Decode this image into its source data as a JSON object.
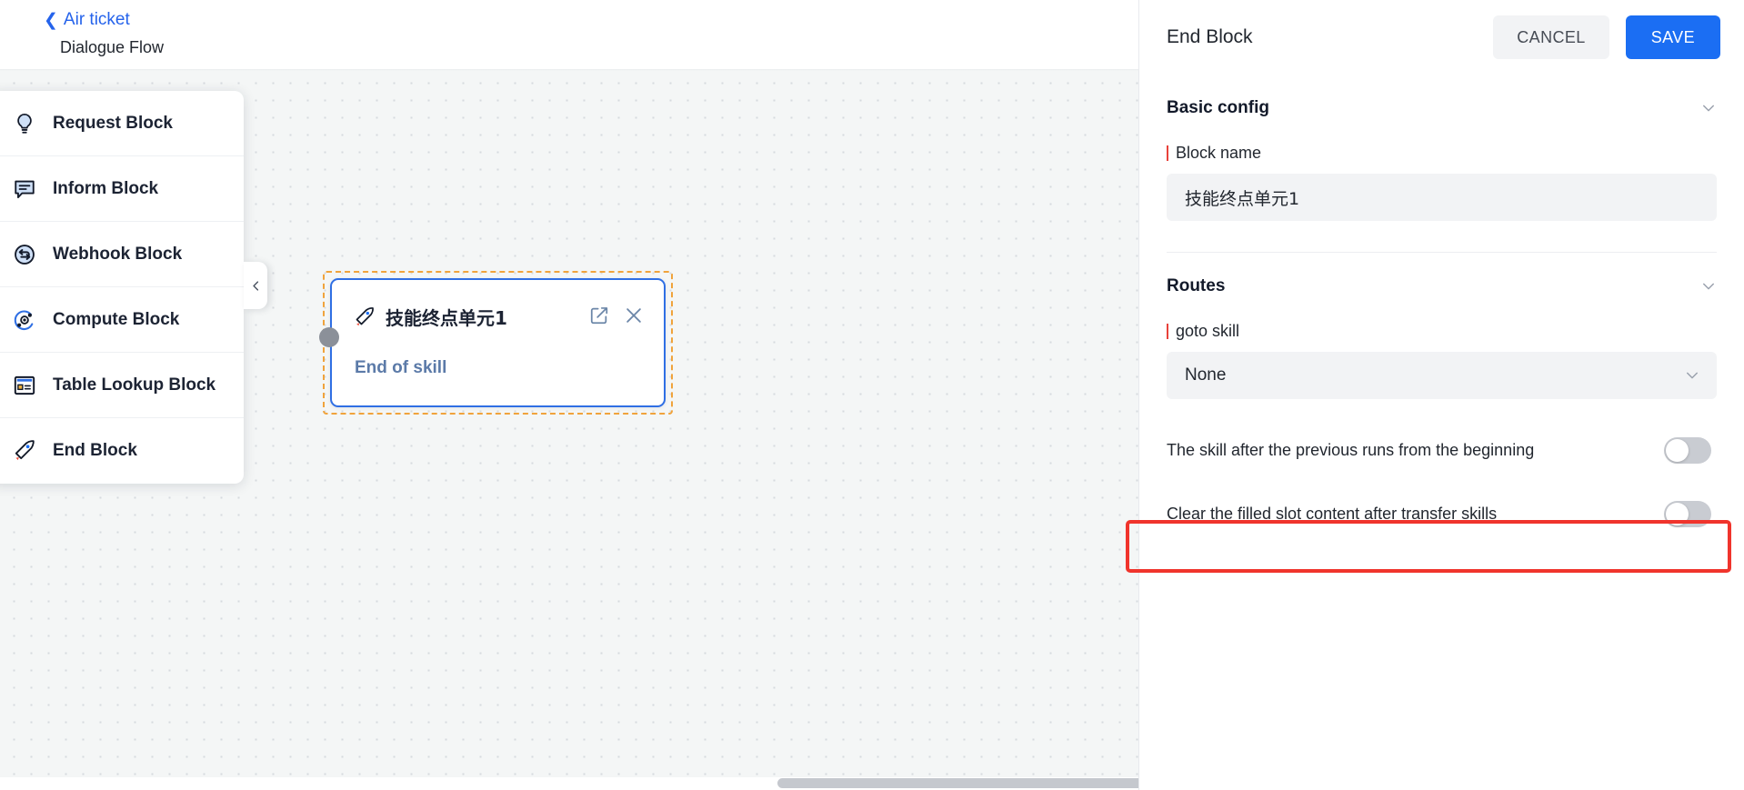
{
  "breadcrumb": {
    "back_icon": "chevron-left-icon",
    "back_label": "Air ticket",
    "sub_label": "Dialogue Flow"
  },
  "palette": {
    "collapse_icon": "chevron-left-icon",
    "items": [
      {
        "label": "Request Block",
        "icon": "lightbulb-icon"
      },
      {
        "label": "Inform Block",
        "icon": "speech-bubble-icon"
      },
      {
        "label": "Webhook Block",
        "icon": "webhook-globe-icon"
      },
      {
        "label": "Compute Block",
        "icon": "atom-compute-icon"
      },
      {
        "label": "Table Lookup Block",
        "icon": "table-window-icon"
      },
      {
        "label": "End Block",
        "icon": "rocket-icon"
      }
    ]
  },
  "node": {
    "icon": "rocket-icon",
    "title": "技能终点单元1",
    "description": "End of skill",
    "edit_icon": "edit-square-icon",
    "close_icon": "close-x-icon",
    "handle": "connector-handle"
  },
  "panel": {
    "title": "End Block",
    "cancel_label": "CANCEL",
    "save_label": "SAVE",
    "sections": {
      "basic": {
        "title": "Basic config",
        "chevron": "chevron-down-icon",
        "block_name": {
          "label": "Block name",
          "required": true,
          "value": "技能终点单元1"
        }
      },
      "routes": {
        "title": "Routes",
        "chevron": "chevron-down-icon",
        "goto_skill": {
          "label": "goto skill",
          "required": true,
          "value": "None",
          "chevron": "chevron-down-icon"
        },
        "toggles": [
          {
            "label": "The skill after the previous runs from the beginning",
            "on": false,
            "highlighted": true
          },
          {
            "label": "Clear the filled slot content after transfer skills",
            "on": false,
            "highlighted": false
          }
        ]
      }
    }
  },
  "colors": {
    "accent_blue": "#1b6ef3",
    "link_blue": "#2563eb",
    "node_border": "#2f6fe4",
    "selection_orange": "#f0a33c",
    "required_red": "#e8413a",
    "highlight_red": "#f0342c",
    "canvas_bg": "#f4f6f6"
  }
}
